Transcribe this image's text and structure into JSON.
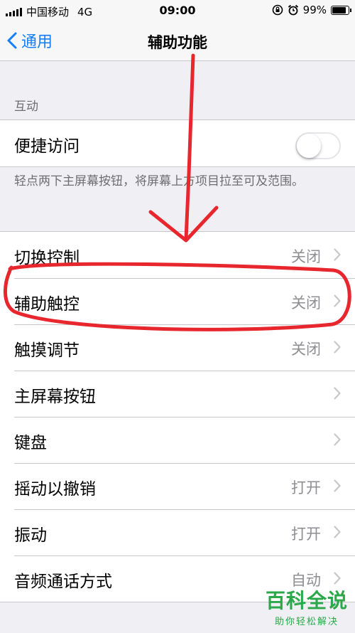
{
  "status_bar": {
    "carrier": "中国移动",
    "network": "4G",
    "time": "09:00",
    "battery": "99%",
    "battery_level": 0.99,
    "icons": [
      "signal-icon",
      "rotation-lock-icon",
      "alarm-icon",
      "battery-icon"
    ]
  },
  "nav": {
    "back_label": "通用",
    "title": "辅助功能"
  },
  "section_interaction": {
    "header": "互动",
    "toggle_row": {
      "label": "便捷访问",
      "on": false
    },
    "footnote": "轻点两下主屏幕按钮，将屏幕上方项目拉至可及范围。"
  },
  "settings_list": [
    {
      "label": "切换控制",
      "value": "关闭"
    },
    {
      "label": "辅助触控",
      "value": "关闭"
    },
    {
      "label": "触摸调节",
      "value": "关闭"
    },
    {
      "label": "主屏幕按钮",
      "value": ""
    },
    {
      "label": "键盘",
      "value": ""
    },
    {
      "label": "摇动以撤销",
      "value": "打开"
    },
    {
      "label": "振动",
      "value": "打开"
    },
    {
      "label": "音频通话方式",
      "value": "自动"
    }
  ],
  "colors": {
    "accent": "#157efb",
    "annotation": "#e8262e",
    "watermark": "#2aa84a",
    "background": "#efeff4"
  },
  "watermark": {
    "main": "百科全说",
    "sub": "助你轻松解决"
  }
}
